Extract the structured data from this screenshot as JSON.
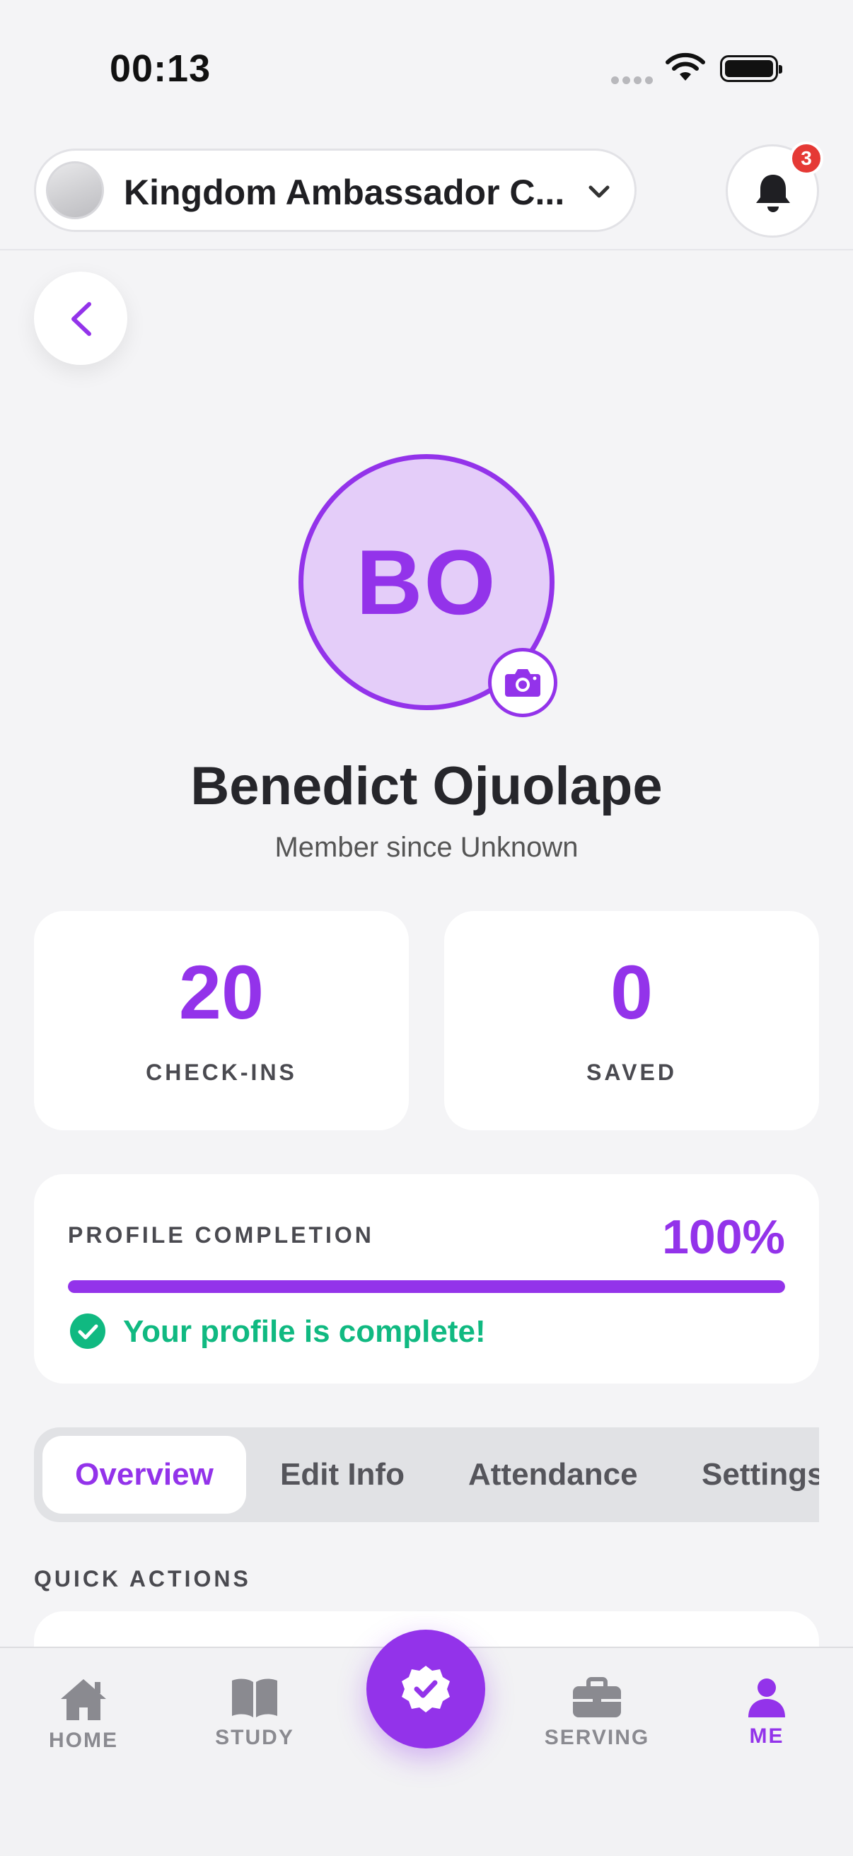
{
  "status_bar": {
    "time": "00:13"
  },
  "header": {
    "church_name": "Kingdom Ambassador C...",
    "notification_count": "3"
  },
  "profile": {
    "initials": "BO",
    "name": "Benedict Ojuolape",
    "member_since": "Member since Unknown"
  },
  "stats": [
    {
      "value": "20",
      "label": "CHECK-INS"
    },
    {
      "value": "0",
      "label": "SAVED"
    }
  ],
  "completion": {
    "title": "PROFILE COMPLETION",
    "value": "100%",
    "progress_fraction": 1.0,
    "message": "Your profile is complete!"
  },
  "tabs": [
    {
      "label": "Overview",
      "active": true
    },
    {
      "label": "Edit Info",
      "active": false
    },
    {
      "label": "Attendance",
      "active": false
    },
    {
      "label": "Settings",
      "active": false
    }
  ],
  "quick_actions": {
    "title": "QUICK ACTIONS"
  },
  "bottom_nav": [
    {
      "label": "HOME",
      "icon": "home-icon"
    },
    {
      "label": "STUDY",
      "icon": "book-icon"
    },
    {
      "label": "",
      "icon": "verified-check-icon"
    },
    {
      "label": "SERVING",
      "icon": "briefcase-icon"
    },
    {
      "label": "ME",
      "icon": "person-icon",
      "active": true
    }
  ],
  "colors": {
    "accent": "#9333ea",
    "accent_light": "#e4cdf9",
    "success": "#10b981",
    "badge": "#e53935",
    "background": "#f4f4f6"
  }
}
